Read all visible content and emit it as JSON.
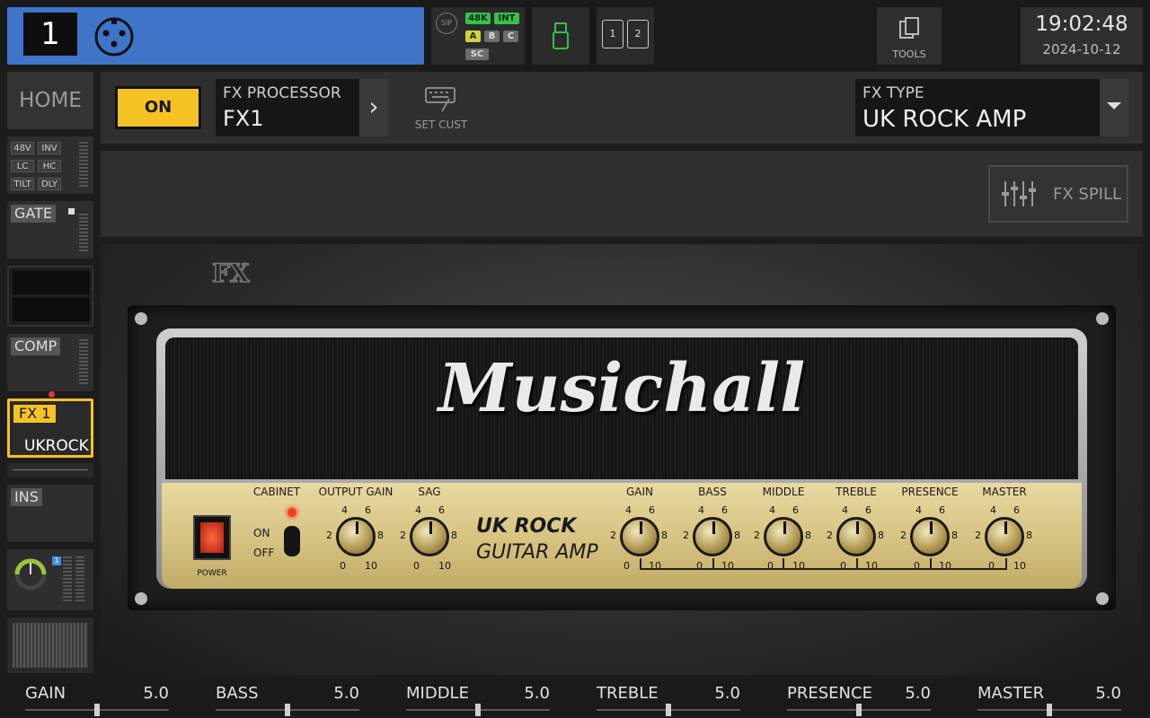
{
  "topbar": {
    "channel_number": "1",
    "status": {
      "sip": "SIP",
      "rate": "48K",
      "clock": "INT",
      "a": "A",
      "b": "B",
      "c": "C",
      "sc": "SC"
    },
    "sd": {
      "slot1": "1",
      "slot2": "2"
    },
    "tools_label": "TOOLS",
    "time": "19:02:48",
    "date": "2024-10-12"
  },
  "sidebar": {
    "home_label": "HOME",
    "input_tags": [
      "48V",
      "INV",
      "LC",
      "HC",
      "TILT",
      "DLY"
    ],
    "gate_label": "GATE",
    "comp_label": "COMP",
    "fx_label": "FX 1",
    "fx_name": "UKROCK",
    "ins_label": "INS",
    "meter_badge": "1"
  },
  "header": {
    "on_label": "ON",
    "fx_processor_label": "FX PROCESSOR",
    "fx_processor_value": "FX1",
    "set_cust_label": "SET CUST",
    "fx_type_label": "FX TYPE",
    "fx_type_value": "UK ROCK AMP"
  },
  "fx_spill_label": "FX SPILL",
  "amp": {
    "brand": "Musichall",
    "model_line1": "UK ROCK",
    "model_line2": "GUITAR AMP",
    "power_label": "POWER",
    "cabinet_label": "CABINET",
    "cabinet_on": "ON",
    "cabinet_off": "OFF",
    "knobs": [
      {
        "label": "OUTPUT GAIN"
      },
      {
        "label": "SAG"
      },
      {
        "label": "GAIN"
      },
      {
        "label": "BASS"
      },
      {
        "label": "MIDDLE"
      },
      {
        "label": "TREBLE"
      },
      {
        "label": "PRESENCE"
      },
      {
        "label": "MASTER"
      }
    ],
    "ticks": {
      "t0": "0",
      "t2": "2",
      "t4": "4",
      "t6": "6",
      "t8": "8",
      "t10": "10"
    }
  },
  "params": [
    {
      "name": "GAIN",
      "value": "5.0"
    },
    {
      "name": "BASS",
      "value": "5.0"
    },
    {
      "name": "MIDDLE",
      "value": "5.0"
    },
    {
      "name": "TREBLE",
      "value": "5.0"
    },
    {
      "name": "PRESENCE",
      "value": "5.0"
    },
    {
      "name": "MASTER",
      "value": "5.0"
    }
  ],
  "colors": {
    "channel_blue": "#3f74c9",
    "on_yellow": "#f5c226",
    "fx_highlight": "#f5c226",
    "status_green": "#36c14b"
  }
}
